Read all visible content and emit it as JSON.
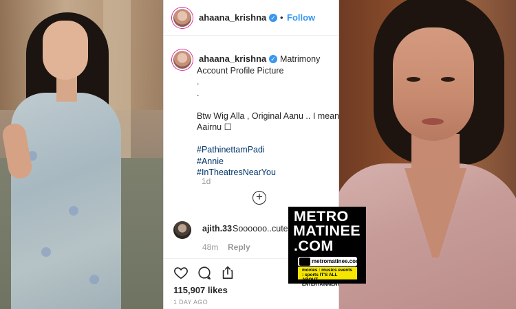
{
  "post": {
    "username": "ahaana_krishna",
    "follow_label": "Follow",
    "separator": "•",
    "caption_lines": [
      "Matrimony",
      "Account Profile Picture",
      ".",
      ".",
      "",
      "Btw Wig Alla , Original Aanu .. I mean",
      "Aairnu ☐"
    ],
    "hashtags": [
      "#PathinettamPadi",
      "#Annie",
      "#InTheatresNearYou"
    ],
    "caption_time": "1d",
    "load_more_symbol": "+",
    "likes": "115,907 likes",
    "date": "1 DAY AGO"
  },
  "comment": {
    "username": "ajith.33",
    "text": "Soooooo..cute",
    "time": "48m",
    "reply_label": "Reply"
  },
  "watermark": {
    "lines": [
      "METRO",
      "MATINEE",
      ".COM"
    ],
    "badge_text": "metromatinee.com",
    "tagline": "movies : musics events : sports IT'S ALL ABOUT ENTERTAINMENT"
  },
  "icons": {
    "like": "heart-icon",
    "comment": "comment-icon",
    "share": "share-icon",
    "verified": "verified-badge-icon"
  },
  "colors": {
    "link_blue": "#3897f0",
    "hashtag": "#003569",
    "muted": "#999999",
    "text": "#262626",
    "logo_yellow": "#f4e600"
  }
}
